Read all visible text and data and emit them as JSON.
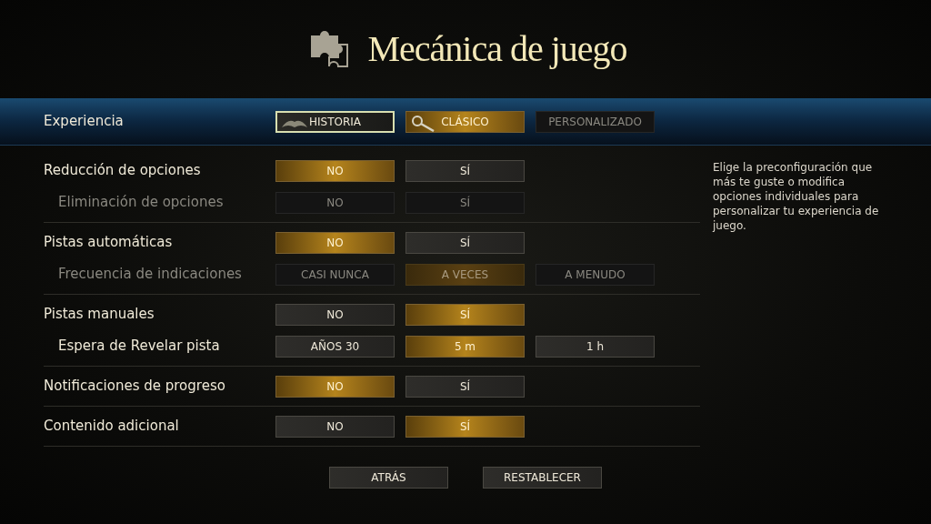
{
  "title": "Mecánica de juego",
  "experience": {
    "label": "Experiencia",
    "options": [
      {
        "label": "HISTORIA",
        "selected": false,
        "focused": true,
        "disabled": false
      },
      {
        "label": "CLÁSICO",
        "selected": true,
        "focused": false,
        "disabled": false
      },
      {
        "label": "PERSONALIZADO",
        "selected": false,
        "focused": false,
        "disabled": true
      }
    ]
  },
  "groups": [
    {
      "rows": [
        {
          "label": "Reducción de opciones",
          "indented": false,
          "disabled": false,
          "options": [
            {
              "label": "NO",
              "selected": true
            },
            {
              "label": "SÍ",
              "selected": false
            }
          ]
        },
        {
          "label": "Eliminación de opciones",
          "indented": true,
          "disabled": true,
          "options": [
            {
              "label": "NO",
              "selected": false
            },
            {
              "label": "SÍ",
              "selected": false
            }
          ]
        }
      ]
    },
    {
      "rows": [
        {
          "label": "Pistas automáticas",
          "indented": false,
          "disabled": false,
          "options": [
            {
              "label": "NO",
              "selected": true
            },
            {
              "label": "SÍ",
              "selected": false
            }
          ]
        },
        {
          "label": "Frecuencia de indicaciones",
          "indented": true,
          "disabled": true,
          "options": [
            {
              "label": "CASI NUNCA",
              "selected": false
            },
            {
              "label": "A VECES",
              "selected": true
            },
            {
              "label": "A MENUDO",
              "selected": false
            }
          ]
        }
      ]
    },
    {
      "rows": [
        {
          "label": "Pistas manuales",
          "indented": false,
          "disabled": false,
          "options": [
            {
              "label": "NO",
              "selected": false
            },
            {
              "label": "SÍ",
              "selected": true
            }
          ]
        },
        {
          "label": "Espera de Revelar pista",
          "indented": true,
          "disabled": false,
          "options": [
            {
              "label": "AÑOS 30",
              "selected": false
            },
            {
              "label": "5 m",
              "selected": true
            },
            {
              "label": "1 h",
              "selected": false
            }
          ]
        }
      ]
    },
    {
      "rows": [
        {
          "label": "Notificaciones de progreso",
          "indented": false,
          "disabled": false,
          "options": [
            {
              "label": "NO",
              "selected": true
            },
            {
              "label": "SÍ",
              "selected": false
            }
          ]
        }
      ]
    },
    {
      "rows": [
        {
          "label": "Contenido adicional",
          "indented": false,
          "disabled": false,
          "options": [
            {
              "label": "NO",
              "selected": false
            },
            {
              "label": "SÍ",
              "selected": true
            }
          ]
        }
      ]
    }
  ],
  "description": "Elige la preconfiguración que más te guste o modifica opciones individuales para personalizar tu experiencia de juego.",
  "buttons": [
    "ATRÁS",
    "RESTABLECER"
  ]
}
